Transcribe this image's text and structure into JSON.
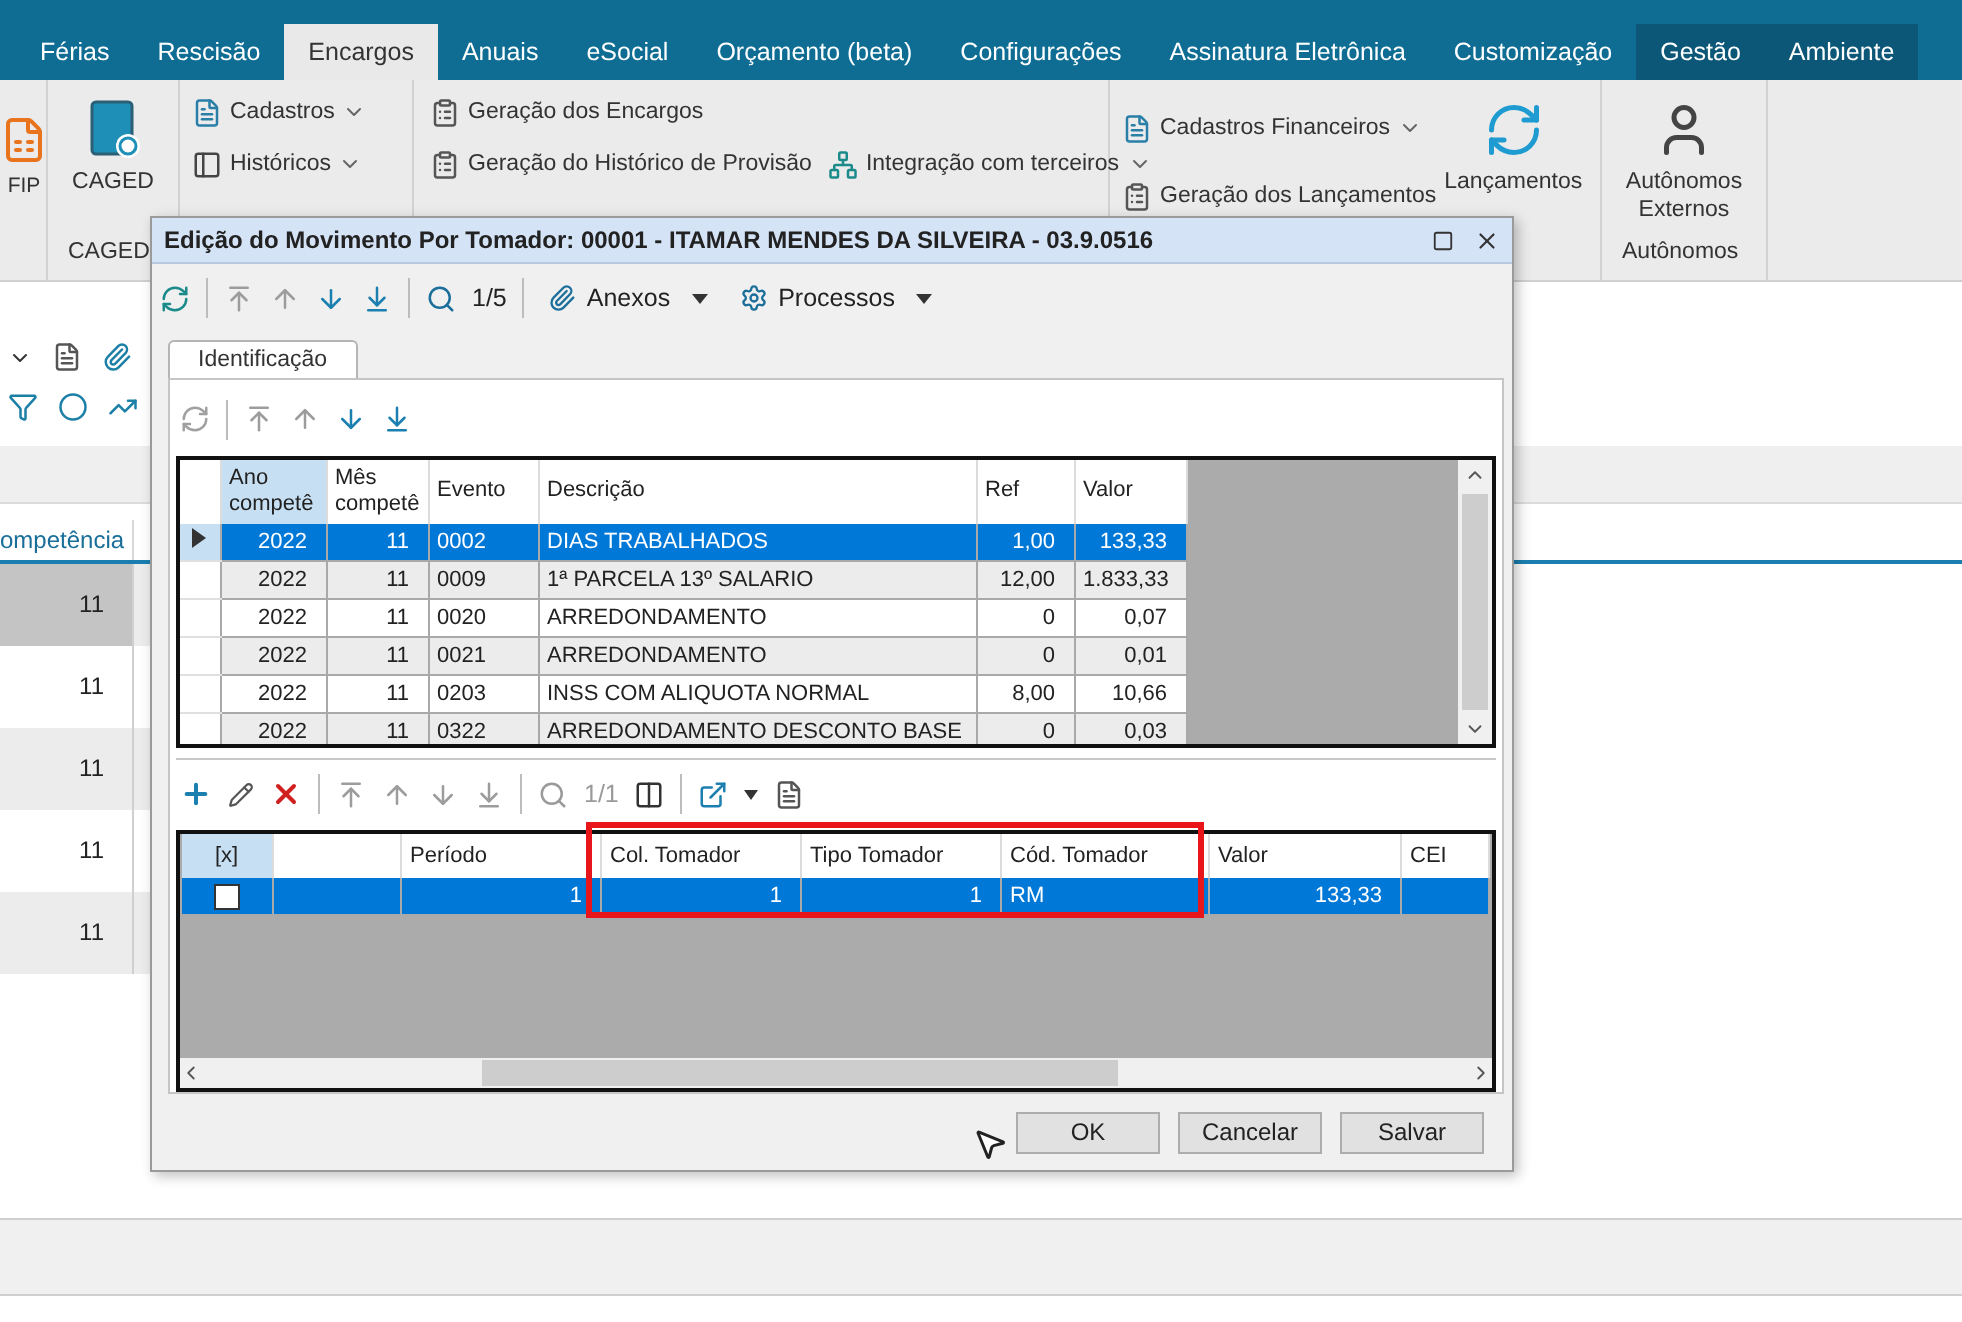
{
  "menu_tabs": [
    {
      "label": "Férias",
      "selected": false,
      "kind": "standard"
    },
    {
      "label": "Rescisão",
      "selected": false,
      "kind": "standard"
    },
    {
      "label": "Encargos",
      "selected": true,
      "kind": "standard"
    },
    {
      "label": "Anuais",
      "selected": false,
      "kind": "standard"
    },
    {
      "label": "eSocial",
      "selected": false,
      "kind": "standard"
    },
    {
      "label": "Orçamento (beta)",
      "selected": false,
      "kind": "standard"
    },
    {
      "label": "Configurações",
      "selected": false,
      "kind": "standard"
    },
    {
      "label": "Assinatura Eletrônica",
      "selected": false,
      "kind": "standard"
    },
    {
      "label": "Customização",
      "selected": false,
      "kind": "standard"
    },
    {
      "label": "Gestão",
      "selected": false,
      "kind": "context"
    },
    {
      "label": "Ambiente",
      "selected": false,
      "kind": "context"
    }
  ],
  "ribbon": {
    "partial_button": "FIP",
    "caged": {
      "button": "CAGED",
      "group_label": "CAGED"
    },
    "dropdowns": [
      "Cadastros",
      "Históricos"
    ],
    "generation": [
      "Geração dos Encargos",
      "Geração do Histórico de Provisão"
    ],
    "integration": "Integração com terceiros",
    "financial": {
      "dropdown": "Cadastros Financeiros",
      "command": "Geração dos Lançamentos",
      "big_button": "Lançamentos"
    },
    "autonomos": {
      "button": "Autônomos Externos",
      "group_label": "Autônomos"
    }
  },
  "background_grid": {
    "column": "ompetência",
    "rows": [
      {
        "value": "11",
        "selected": true
      },
      {
        "value": "11",
        "selected": false
      },
      {
        "value": "11",
        "selected": false
      },
      {
        "value": "11",
        "selected": false
      },
      {
        "value": "11",
        "selected": false
      }
    ]
  },
  "dialog": {
    "title": "Edição do Movimento Por Tomador: 00001 - ITAMAR MENDES DA SILVEIRA - 03.9.0516",
    "navigation": [
      {
        "kind": "first",
        "disabled": true
      },
      {
        "kind": "previous",
        "disabled": true
      },
      {
        "kind": "next",
        "disabled": false
      },
      {
        "kind": "last",
        "disabled": false
      }
    ],
    "record_counter": "1/5",
    "menus": [
      "Anexos",
      "Processos"
    ],
    "tabs": [
      {
        "label": "Identificação",
        "selected": true
      }
    ],
    "events_navigation": [
      {
        "kind": "first",
        "disabled": true
      },
      {
        "kind": "previous",
        "disabled": true
      },
      {
        "kind": "next",
        "disabled": false
      },
      {
        "kind": "last",
        "disabled": false
      }
    ],
    "events_table": {
      "columns": [
        "Ano competê",
        "Mês competê",
        "Evento",
        "Descrição",
        "Ref",
        "Valor"
      ],
      "rows": [
        {
          "selected": true,
          "cells": [
            "2022",
            "11",
            "0002",
            "DIAS TRABALHADOS",
            "1,00",
            "133,33"
          ]
        },
        {
          "selected": false,
          "cells": [
            "2022",
            "11",
            "0009",
            "1ª PARCELA 13º SALARIO",
            "12,00",
            "1.833,33"
          ]
        },
        {
          "selected": false,
          "cells": [
            "2022",
            "11",
            "0020",
            "ARREDONDAMENTO",
            "0",
            "0,07"
          ]
        },
        {
          "selected": false,
          "cells": [
            "2022",
            "11",
            "0021",
            "ARREDONDAMENTO",
            "0",
            "0,01"
          ]
        },
        {
          "selected": false,
          "cells": [
            "2022",
            "11",
            "0203",
            "INSS COM ALIQUOTA NORMAL",
            "8,00",
            "10,66"
          ]
        },
        {
          "selected": false,
          "cells": [
            "2022",
            "11",
            "0322",
            "ARREDONDAMENTO DESCONTO BASE",
            "0",
            "0,03"
          ]
        }
      ]
    },
    "tomador_navigation": [
      {
        "kind": "first",
        "disabled": true
      },
      {
        "kind": "previous",
        "disabled": true
      },
      {
        "kind": "next",
        "disabled": true
      },
      {
        "kind": "last",
        "disabled": true
      }
    ],
    "tomador_counter": {
      "text": "1/1",
      "disabled": true
    },
    "tomador_table": {
      "columns": [
        "[x]",
        "",
        "Período",
        "Col. Tomador",
        "Tipo Tomador",
        "Cód. Tomador",
        "Valor",
        "CEI"
      ],
      "rows": [
        {
          "selected": true,
          "checked": false,
          "cells": [
            "",
            "",
            "1",
            "1",
            "1",
            "RM",
            "133,33",
            ""
          ]
        }
      ]
    },
    "buttons": [
      "OK",
      "Cancelar",
      "Salvar"
    ]
  }
}
